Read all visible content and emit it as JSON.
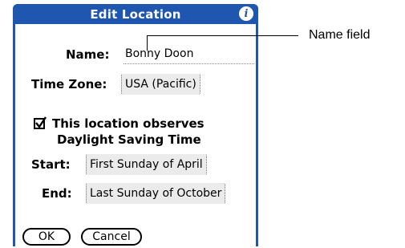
{
  "dialog": {
    "title": "Edit Location",
    "info_icon": "info-icon",
    "name_label": "Name:",
    "name_value": "Bonny Doon",
    "timezone_label": "Time Zone:",
    "timezone_value": "USA (Pacific)",
    "dst_line1": "This location observes",
    "dst_line2": "Daylight Saving Time",
    "dst_checked": true,
    "start_label": "Start:",
    "start_value": "First Sunday of April",
    "end_label": "End:",
    "end_value": "Last Sunday of October",
    "ok_label": "OK",
    "cancel_label": "Cancel"
  },
  "callout": {
    "label": "Name field"
  },
  "colors": {
    "titlebar": "#1f57b0",
    "picker_bg": "#ebebeb"
  }
}
